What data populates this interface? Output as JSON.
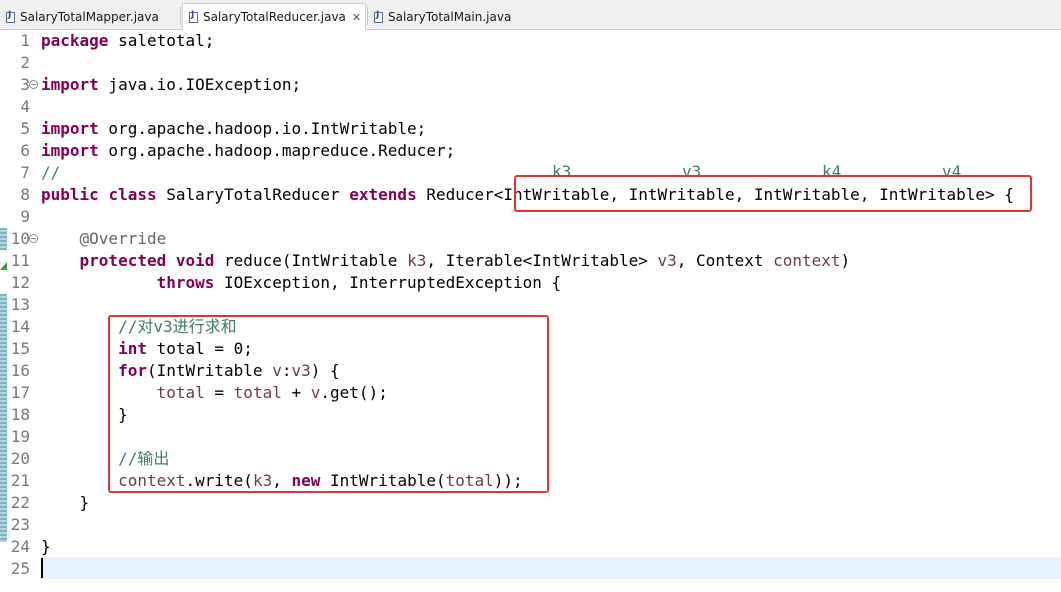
{
  "tabs": [
    {
      "label": "SalaryTotalMapper.java",
      "active": false
    },
    {
      "label": "SalaryTotalReducer.java",
      "active": true,
      "close": "✕"
    },
    {
      "label": "SalaryTotalMain.java",
      "active": false
    }
  ],
  "icons": {
    "tab_file": "java-file-icon",
    "fold": "fold-collapse-icon",
    "close": "close-icon"
  },
  "colors": {
    "keyword": "#7f0055",
    "comment": "#3f7f5f",
    "annotation": "#646464",
    "parameter": "#6a3e3e",
    "highlight_box": "#e8312f",
    "current_line": "#e8f2fe"
  },
  "code": {
    "line_numbers": [
      "1",
      "2",
      "3",
      "4",
      "5",
      "6",
      "7",
      "8",
      "9",
      "10",
      "11",
      "12",
      "13",
      "14",
      "15",
      "16",
      "17",
      "18",
      "19",
      "20",
      "21",
      "22",
      "23",
      "24",
      "25"
    ],
    "l1": {
      "kw": "package",
      "rest": " saletotal;"
    },
    "l3": {
      "kw": "import",
      "rest": " java.io.IOException;"
    },
    "l5": {
      "kw": "import",
      "rest": " org.apache.hadoop.io.IntWritable;"
    },
    "l6": {
      "kw": "import",
      "rest": " org.apache.hadoop.mapreduce.Reducer;"
    },
    "l7": {
      "comment": "//"
    },
    "l7_labels": [
      "k3",
      "v3",
      "k4",
      "v4"
    ],
    "l8": {
      "kw1": "public",
      "kw2": "class",
      "name": " SalaryTotalReducer ",
      "kw3": "extends",
      "rest": " Reducer<IntWritable, IntWritable, IntWritable, IntWritable> {"
    },
    "l10": {
      "annotation": "@Override"
    },
    "l11": {
      "kw1": "protected",
      "kw2": "void",
      "a": " reduce(IntWritable ",
      "p1": "k3",
      "b": ", Iterable<IntWritable> ",
      "p2": "v3",
      "c": ", Context ",
      "p3": "context",
      "d": ")"
    },
    "l12": {
      "kw": "throws",
      "rest": " IOException, InterruptedException {"
    },
    "l14": {
      "comment": "//对v3进行求和"
    },
    "l15": {
      "kw": "int",
      "rest": " total = 0;"
    },
    "l16": {
      "kw": "for",
      "a": "(IntWritable ",
      "p1": "v",
      "b": ":",
      "p2": "v3",
      "c": ") {"
    },
    "l17": {
      "p1": "total",
      "a": " = ",
      "p2": "total",
      "b": " + ",
      "p3": "v",
      "c": ".get();"
    },
    "l18": {
      "text": "}"
    },
    "l20": {
      "comment": "//输出"
    },
    "l21": {
      "p1": "context",
      "a": ".write(",
      "p2": "k3",
      "b": ", ",
      "kw": "new",
      "c": " IntWritable(",
      "p3": "total",
      "d": "));"
    },
    "l22": {
      "text": "}"
    },
    "l24": {
      "text": "}"
    }
  }
}
